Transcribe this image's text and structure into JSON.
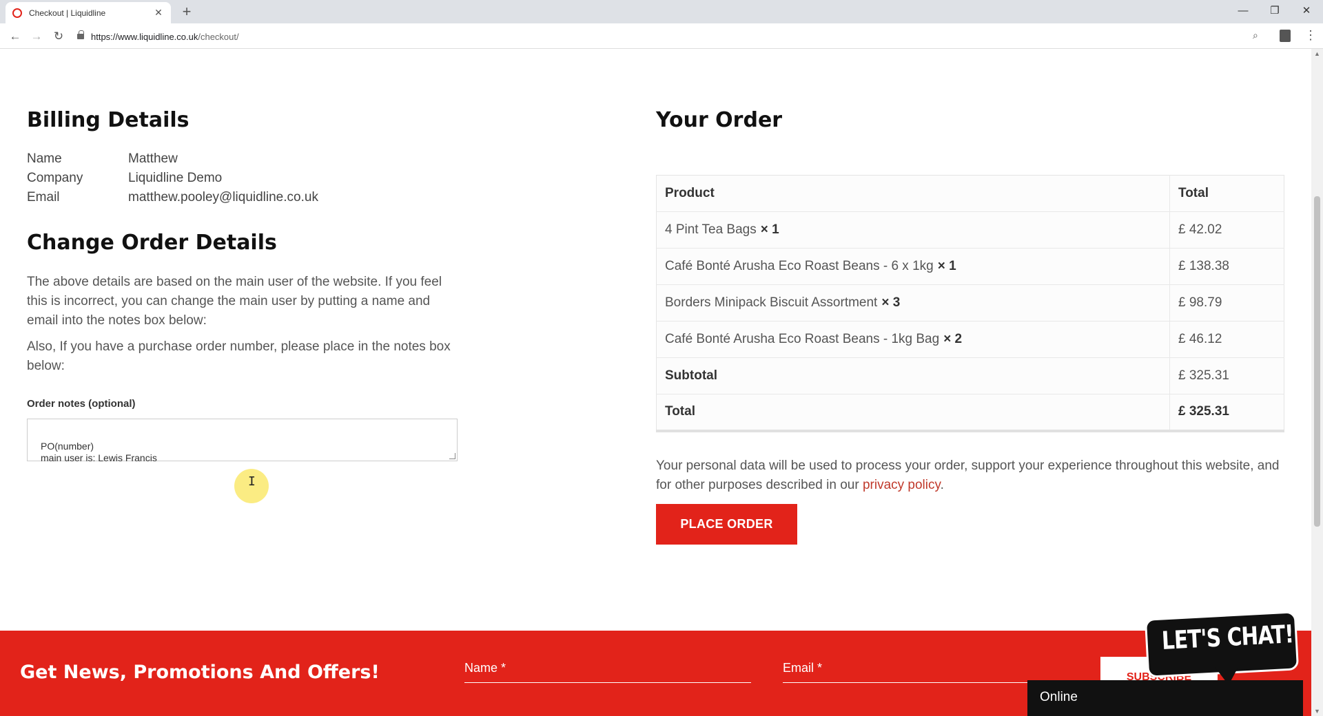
{
  "browser": {
    "tab_title": "Checkout | Liquidline",
    "url_host": "https://www.liquidline.co.uk",
    "url_path": "/checkout/"
  },
  "billing": {
    "title": "Billing Details",
    "rows": [
      {
        "label": "Name",
        "value": "Matthew"
      },
      {
        "label": "Company",
        "value": "Liquidline Demo"
      },
      {
        "label": "Email",
        "value": "matthew.pooley@liquidline.co.uk"
      }
    ]
  },
  "change": {
    "title": "Change Order Details",
    "para1": "The above details are based on the main user of the website. If you feel this is incorrect, you can change the main user by putting a name and email into the notes box below:",
    "para2": "Also, If you have a purchase order number, please place in the notes box below:",
    "notes_label": "Order notes (optional)",
    "notes_value": "PO(number)\nmain user is: Lewis Francis"
  },
  "order": {
    "title": "Your Order",
    "col_product": "Product",
    "col_total": "Total",
    "items": [
      {
        "name": "4 Pint Tea Bags",
        "qty": "× 1",
        "total": "£ 42.02"
      },
      {
        "name": "Café Bonté Arusha Eco Roast Beans - 6 x 1kg",
        "qty": "× 1",
        "total": "£ 138.38"
      },
      {
        "name": "Borders Minipack Biscuit Assortment",
        "qty": "× 3",
        "total": "£ 98.79"
      },
      {
        "name": "Café Bonté Arusha Eco Roast Beans - 1kg Bag",
        "qty": "× 2",
        "total": "£ 46.12"
      }
    ],
    "subtotal_label": "Subtotal",
    "subtotal": "£ 325.31",
    "total_label": "Total",
    "total": "£ 325.31",
    "privacy_text": "Your personal data will be used to process your order, support your experience throughout this website, and for other purposes described in our ",
    "privacy_link": "privacy policy",
    "privacy_end": ".",
    "place_order": "PLACE ORDER"
  },
  "newsletter": {
    "heading": "Get News, Promotions And Offers!",
    "name_placeholder": "Name *",
    "email_placeholder": "Email *",
    "subscribe": "SUBSCRIBE"
  },
  "chat": {
    "bubble": "LET'S CHAT!",
    "status": "Online"
  },
  "colors": {
    "brand_red": "#e2231a",
    "link_red": "#c0392b"
  }
}
